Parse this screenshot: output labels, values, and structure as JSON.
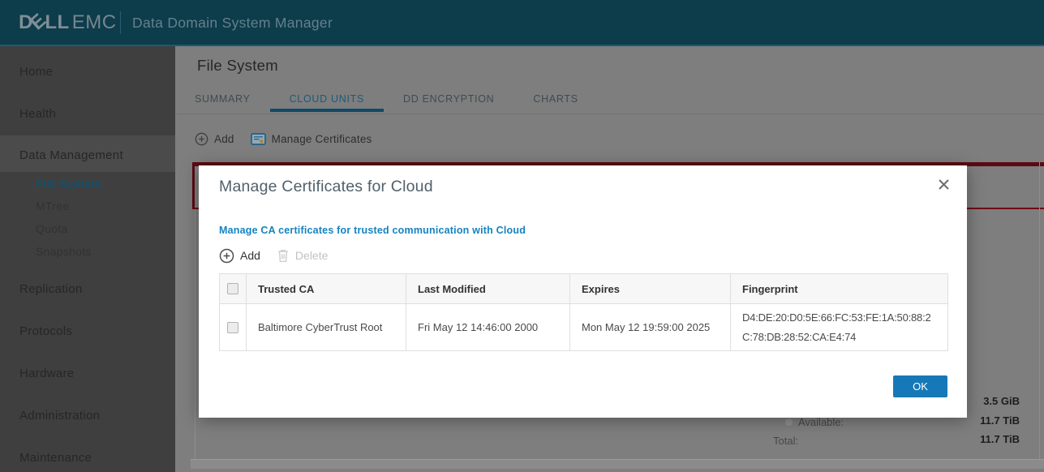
{
  "header": {
    "logo": {
      "d": "D",
      "e": "E",
      "ll": "LL",
      "emc": "EMC"
    },
    "app_title": "Data Domain System Manager"
  },
  "sidebar": {
    "items": [
      "Home",
      "Health",
      "Data Management",
      "File System",
      "MTree",
      "Quota",
      "Snapshots",
      "Replication",
      "Protocols",
      "Hardware",
      "Administration",
      "Maintenance"
    ],
    "active_item": "File System"
  },
  "content": {
    "page_title": "File System",
    "tabs": [
      {
        "label": "SUMMARY",
        "active": false
      },
      {
        "label": "CLOUD UNITS",
        "active": true
      },
      {
        "label": "DD ENCRYPTION",
        "active": false
      },
      {
        "label": "CHARTS",
        "active": false
      }
    ],
    "toolbar": {
      "add_label": "Add",
      "manage_certificates_label": "Manage Certificates"
    },
    "stats": {
      "capacity_value": "3.5 GiB",
      "available_label": "Available:",
      "available_value": "11.7 TiB",
      "total_label": "Total:",
      "total_value": "11.7 TiB"
    }
  },
  "modal": {
    "title": "Manage Certificates for Cloud",
    "description": "Manage CA certificates for trusted communication with Cloud",
    "add_label": "Add",
    "delete_label": "Delete",
    "ok_label": "OK",
    "table": {
      "headers": [
        "Trusted CA",
        "Last Modified",
        "Expires",
        "Fingerprint"
      ],
      "rows": [
        {
          "trusted_ca": "Baltimore CyberTrust Root",
          "last_modified": "Fri May 12 14:46:00 2000",
          "expires": "Mon May 12 19:59:00 2025",
          "fingerprint": "D4:DE:20:D0:5E:66:FC:53:FE:1A:50:88:2C:78:DB:28:52:CA:E4:74"
        }
      ]
    }
  },
  "icons": {
    "add": "plus-circle-icon",
    "manage_certificates": "certificate-icon",
    "delete": "trash-icon",
    "close": "close-icon",
    "available_marker": "dot-icon"
  },
  "colors": {
    "header_teal": "#0d3c4b",
    "accent_blue": "#1778b8",
    "link_blue": "#1583c1",
    "active_tab_blue": "#1d5a78",
    "alert_red": "#5c0913"
  }
}
